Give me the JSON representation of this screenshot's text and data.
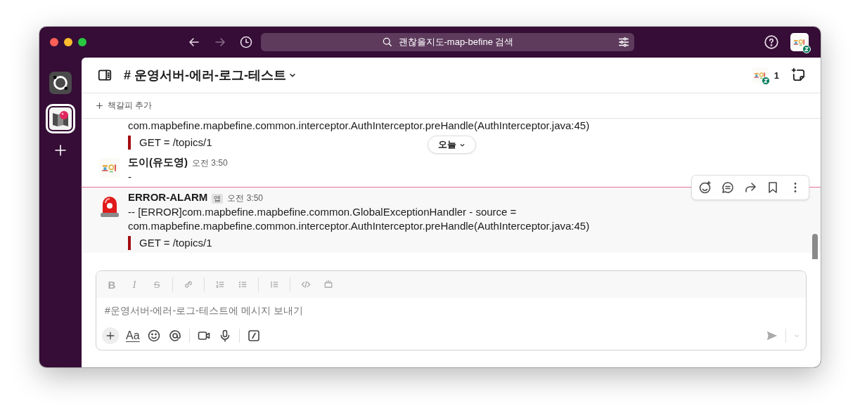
{
  "window": {
    "search": "괜찮을지도-map-befine 검색"
  },
  "workspaces": [
    {
      "selected": false
    },
    {
      "selected": true
    }
  ],
  "channel": {
    "name": "# 운영서버-에러-로그-테스트",
    "member_count": "1"
  },
  "bookmarks": {
    "add_label": "책갈피 추가"
  },
  "date_pill": "오늘",
  "messages": [
    {
      "kind": "continuation",
      "text": "com.mapbefine.mapbefine.common.interceptor.AuthInterceptor.preHandle(AuthInterceptor.java:45)",
      "quote": "GET = /topics/1",
      "hovered": false,
      "unread_divider": false
    },
    {
      "kind": "message",
      "avatar": {
        "kind": "user"
      },
      "author": "도이(유도영)",
      "time": "오전 3:50",
      "text": "-",
      "hovered": false,
      "unread_divider": false
    },
    {
      "kind": "message",
      "avatar": {
        "kind": "siren"
      },
      "author": "ERROR-ALARM",
      "badge": "앱",
      "time": "오전 3:50",
      "text": "-- [ERROR]com.mapbefine.mapbefine.common.GlobalExceptionHandler - source = com.mapbefine.mapbefine.common.interceptor.AuthInterceptor.preHandle(AuthInterceptor.java:45)",
      "quote": "GET = /topics/1",
      "hovered": true,
      "unread_divider": true
    }
  ],
  "composer": {
    "format_marks": [
      "B",
      "I",
      "S"
    ],
    "formatting_disabled": true,
    "text_style": "Aa",
    "placeholder": "#운영서버-에러-로그-테스트에 메시지 보내기"
  }
}
